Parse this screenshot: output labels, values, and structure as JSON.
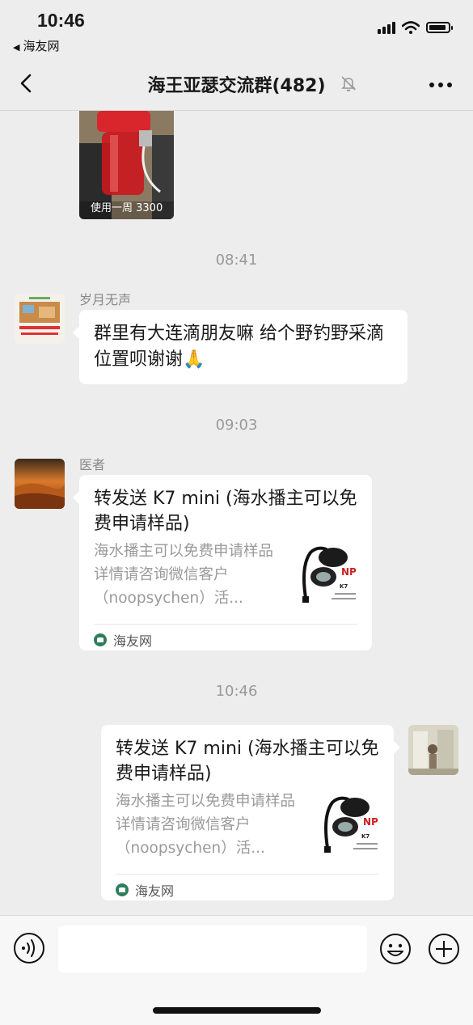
{
  "status_bar": {
    "time": "10:46",
    "back_app": "海友网"
  },
  "nav": {
    "title": "海王亚瑟交流群(482)"
  },
  "messages": {
    "image_caption": "使用一周 3300",
    "ts1": "08:41",
    "msg1": {
      "sender": "岁月无声",
      "text": "群里有大连滴朋友嘛 给个野钓野采滴位置呗谢谢🙏"
    },
    "ts2": "09:03",
    "msg2": {
      "sender": "医者",
      "title": "转发送 K7 mini (海水播主可以免费申请样品)",
      "desc": "海水播主可以免费申请样品详情请咨询微信客户（noopsychen）活...",
      "source": "海友网"
    },
    "ts3": "10:46",
    "msg3": {
      "title": "转发送 K7 mini (海水播主可以免费申请样品)",
      "desc": "海水播主可以免费申请样品详情请咨询微信客户（noopsychen）活...",
      "source": "海友网"
    }
  },
  "colors": {
    "background": "#EDEDED",
    "bubble": "#FFFFFF",
    "timestamp": "#999999"
  },
  "icons": [
    "back-chevron-icon",
    "mute-bell-icon",
    "more-icon",
    "voice-icon",
    "emoji-icon",
    "plus-icon"
  ]
}
